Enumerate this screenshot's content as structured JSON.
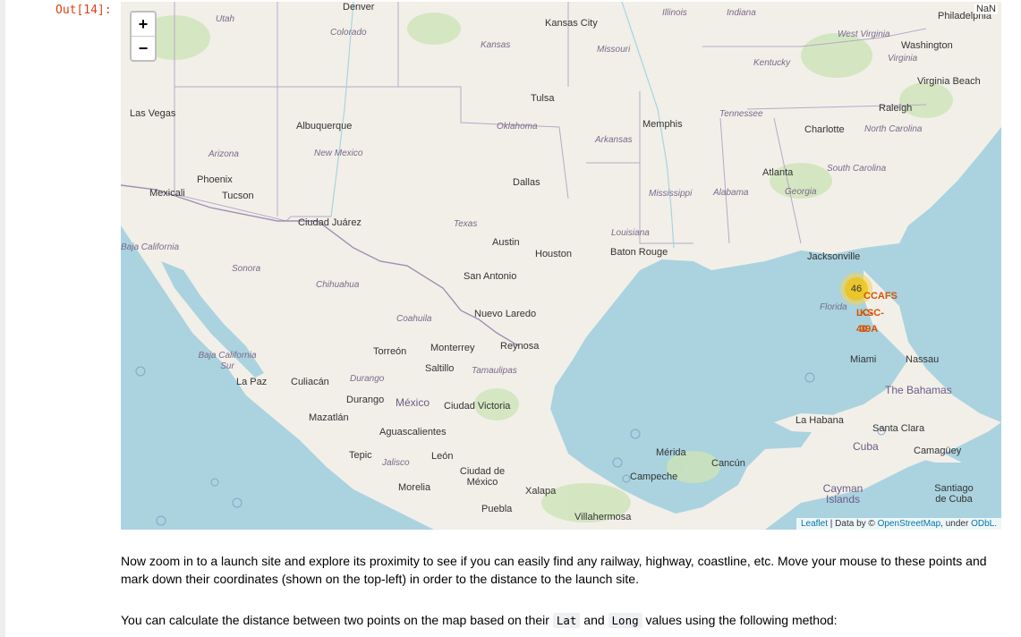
{
  "prompt": "Out[14]:",
  "map": {
    "zoom_in": "+",
    "zoom_out": "−",
    "nan_label": "NaN",
    "cluster_count": "46",
    "sites": [
      "CCAFS",
      "LC-",
      "40",
      "KSC-",
      "39A"
    ],
    "attribution": {
      "leaflet": "Leaflet",
      "sep": " | Data by © ",
      "osm": "OpenStreetMap",
      "under": ", under ",
      "odbl": "ODbL."
    },
    "cities": [
      "Denver",
      "Kansas City",
      "Las Vegas",
      "Albuquerque",
      "Tulsa",
      "Memphis",
      "Raleigh",
      "Washington",
      "Virginia Beach",
      "Charlotte",
      "Atlanta",
      "Phoenix",
      "Tucson",
      "Mexicali",
      "Dallas",
      "Ciudad Juárez",
      "Austin",
      "Houston",
      "Baton Rouge",
      "Jacksonville",
      "San Antonio",
      "Nuevo Laredo",
      "Monterrey",
      "Reynosa",
      "Torreón",
      "Saltillo",
      "Miami",
      "Nassau",
      "La Paz",
      "Culiacán",
      "Durango",
      "Ciudad Victoria",
      "Mazatlán",
      "La Habana",
      "Santa Clara",
      "Aguascalientes",
      "Mérida",
      "Cancún",
      "Camagüey",
      "Tepic",
      "León",
      "Campeche",
      "Ciudad de México",
      "Morelia",
      "Xalapa",
      "Puebla",
      "Villahermosa",
      "Santiago de Cuba",
      "Philadelphia"
    ],
    "states": [
      "Utah",
      "Colorado",
      "Kansas",
      "Missouri",
      "Illinois",
      "Indiana",
      "West Virginia",
      "Virginia",
      "Kentucky",
      "Tennessee",
      "North Carolina",
      "Oklahoma",
      "Arkansas",
      "New Mexico",
      "Arizona",
      "South Carolina",
      "Georgia",
      "Mississippi",
      "Alabama",
      "Texas",
      "Louisiana",
      "Baja California",
      "Sonora",
      "Chihuahua",
      "Coahuila",
      "Florida",
      "Baja California Sur",
      "Durango",
      "Tamaulipas",
      "Jalisco"
    ],
    "countries": [
      "México",
      "Cuba",
      "The Bahamas",
      "Cayman Islands"
    ]
  },
  "para1": "Now zoom in to a launch site and explore its proximity to see if you can easily find any railway, highway, coastline, etc. Move your mouse to these points and mark down their coordinates (shown on the top-left) in order to the distance to the launch site.",
  "para2": {
    "before": "You can calculate the distance between two points on the map based on their ",
    "code1": "Lat",
    "and": " and ",
    "code2": "Long",
    "after": " values using the following method:"
  },
  "colors": {
    "water": "#aad3df",
    "land": "#f2efe9",
    "accent": "#d84315",
    "link": "#0078a8"
  }
}
